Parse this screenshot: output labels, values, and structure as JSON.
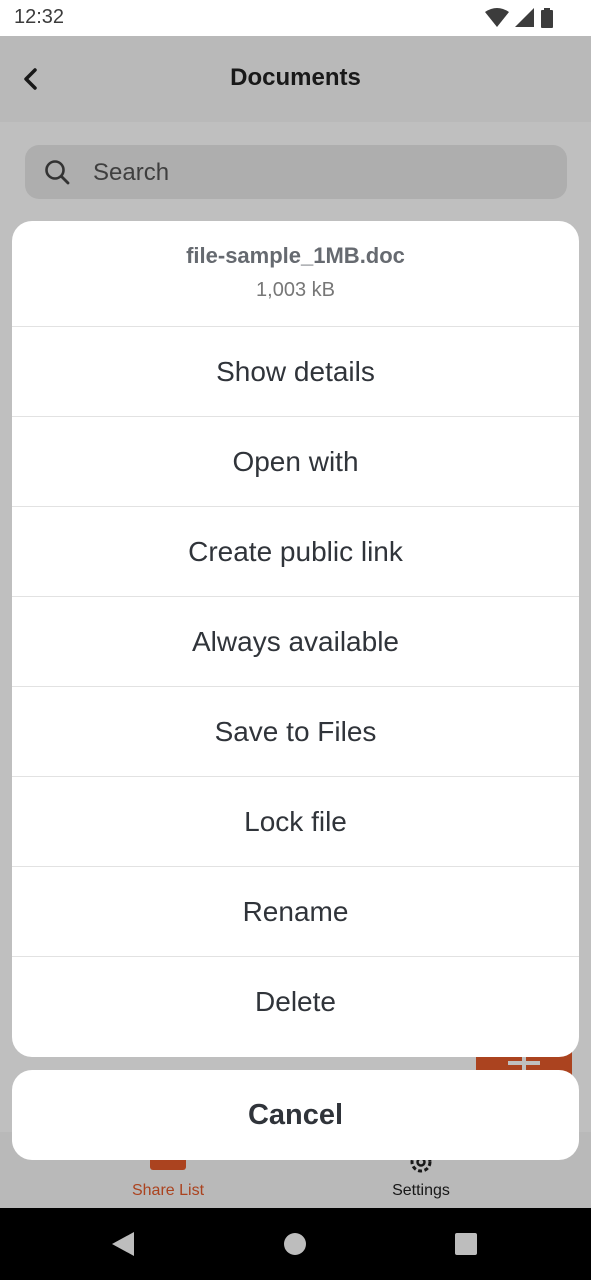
{
  "status_bar": {
    "time": "12:32",
    "icons": [
      "wifi-icon",
      "signal-icon",
      "battery-icon"
    ]
  },
  "header": {
    "title": "Documents",
    "back_icon": "chevron-left-icon"
  },
  "search": {
    "placeholder": "Search"
  },
  "action_sheet": {
    "file_name": "file-sample_1MB.doc",
    "file_size": "1,003 kB",
    "items": [
      {
        "label": "Show details"
      },
      {
        "label": "Open with"
      },
      {
        "label": "Create public link"
      },
      {
        "label": "Always available"
      },
      {
        "label": "Save to Files"
      },
      {
        "label": "Lock file"
      },
      {
        "label": "Rename"
      },
      {
        "label": "Delete"
      }
    ],
    "cancel_label": "Cancel"
  },
  "bottom_nav": {
    "items": [
      {
        "label": "Share List",
        "icon": "share-list-icon",
        "active": true
      },
      {
        "label": "Settings",
        "icon": "gear-icon",
        "active": false
      }
    ]
  },
  "fab": {
    "icon": "plus-icon"
  },
  "system_nav": {
    "icons": [
      "back-triangle-icon",
      "home-circle-icon",
      "recents-square-icon"
    ]
  },
  "colors": {
    "accent": "#e55a2a",
    "text_primary": "#30343a",
    "sheet_background": "#ffffff",
    "scrim": "rgba(0,0,0,0.25)"
  }
}
